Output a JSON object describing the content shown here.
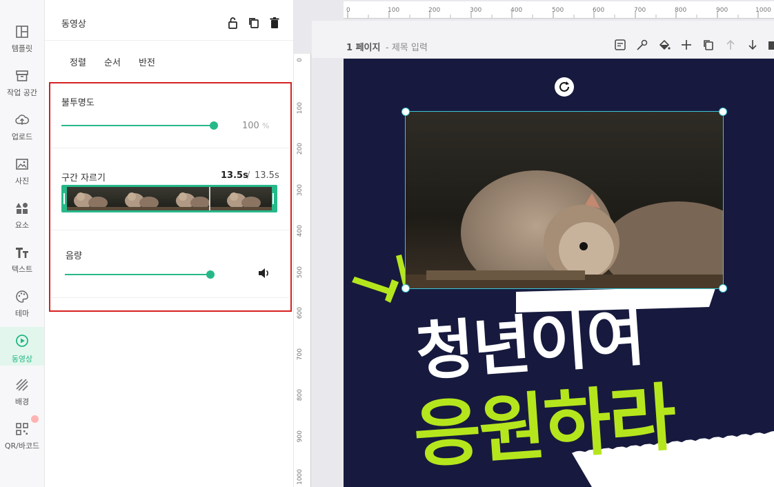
{
  "rail": {
    "items": [
      {
        "label": "템플릿",
        "icon": "template-icon"
      },
      {
        "label": "작업 공간",
        "icon": "workspace-icon"
      },
      {
        "label": "업로드",
        "icon": "upload-cloud-icon"
      },
      {
        "label": "사진",
        "icon": "photo-icon"
      },
      {
        "label": "요소",
        "icon": "elements-icon"
      },
      {
        "label": "텍스트",
        "icon": "text-icon"
      },
      {
        "label": "테마",
        "icon": "palette-icon"
      },
      {
        "label": "동영상",
        "icon": "video-play-icon",
        "active": true
      },
      {
        "label": "배경",
        "icon": "background-icon"
      },
      {
        "label": "QR/바코드",
        "icon": "qr-icon"
      }
    ]
  },
  "panel": {
    "title": "동영상",
    "tabs": [
      "정렬",
      "순서",
      "반전"
    ],
    "opacity": {
      "label": "불투명도",
      "value": "100",
      "unit": "%",
      "level": 1.0
    },
    "trim": {
      "label": "구간 자르기",
      "current": "13.5s",
      "separator": "/",
      "total": "13.5s"
    },
    "volume": {
      "label": "음량",
      "level": 1.0
    }
  },
  "canvas": {
    "page_label": "1 페이지",
    "page_title_placeholder": "- 제목 입력",
    "ruler_top": [
      "0",
      "100",
      "200",
      "300",
      "400",
      "500",
      "600",
      "700",
      "800",
      "900",
      "1000"
    ],
    "ruler_left": [
      "0",
      "100",
      "200",
      "300",
      "400",
      "500",
      "600",
      "700",
      "800",
      "900",
      "1000"
    ],
    "headline_line1": "청년이여",
    "headline_line2": "응원하라"
  },
  "colors": {
    "accent": "#27b88a",
    "selection": "#3cc6d8",
    "highlight_box": "#d62020",
    "page_bg": "#171a3e",
    "lime": "#b5e61d"
  }
}
